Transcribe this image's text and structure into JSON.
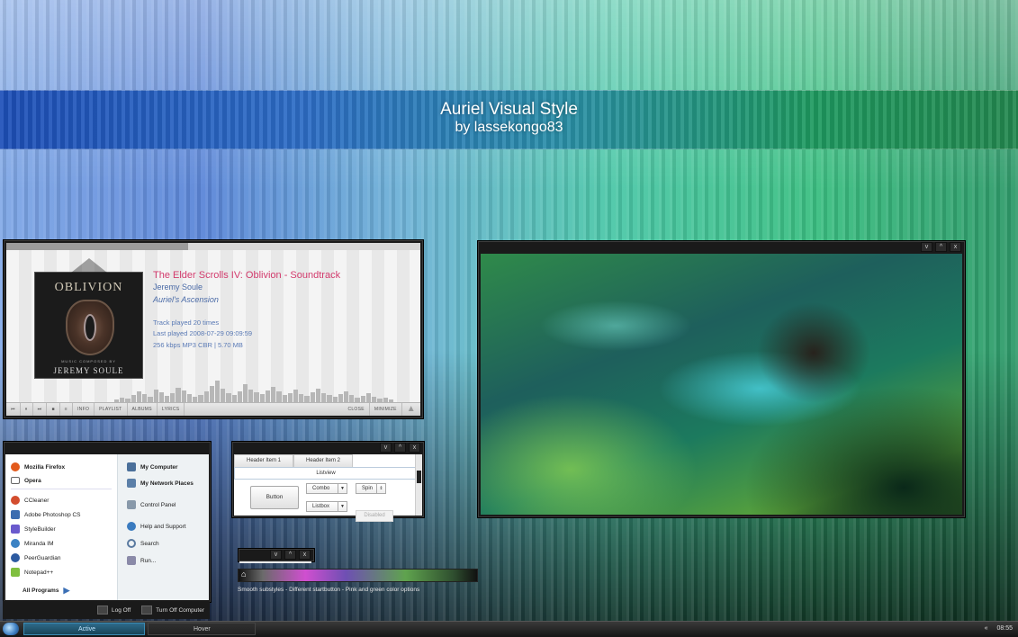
{
  "header": {
    "title": "Auriel Visual Style",
    "author": "by lassekongo83"
  },
  "player": {
    "album_art": {
      "logo": "OBLIVION",
      "composed_by": "MUSIC COMPOSED BY",
      "artist": "JEREMY SOULE"
    },
    "album": "The Elder Scrolls IV: Oblivion - Soundtrack",
    "artist": "Jeremy Soule",
    "track": "Auriel's Ascension",
    "plays": "Track played 20 times",
    "last_played": "Last played 2008-07-29 09:09:59",
    "bitrate": "256 kbps MP3 CBR | 5.70 MB",
    "seek_progress": 0.44,
    "controls": [
      "⏮",
      "⏸",
      "⏭",
      "■",
      "≡"
    ],
    "tabs": [
      "INFO",
      "PLAYLIST",
      "ALBUMS",
      "LYRICS"
    ],
    "right_buttons": [
      "CLOSE",
      "MINIMIZE"
    ]
  },
  "start_menu": {
    "pinned": [
      {
        "label": "Mozilla Firefox",
        "icon": "firefox-icon",
        "color": "#e25a1c"
      },
      {
        "label": "Opera",
        "icon": "mail-icon",
        "color": "#c0392b"
      }
    ],
    "recent": [
      {
        "label": "CCleaner",
        "icon": "ccleaner-icon",
        "color": "#d34d2e"
      },
      {
        "label": "Adobe Photoshop CS",
        "icon": "photoshop-icon",
        "color": "#3c6db0"
      },
      {
        "label": "StyleBuilder",
        "icon": "stylebuilder-icon",
        "color": "#6a5acd"
      },
      {
        "label": "Miranda IM",
        "icon": "miranda-icon",
        "color": "#3b82c4"
      },
      {
        "label": "PeerGuardian",
        "icon": "peerguardian-icon",
        "color": "#2c5aa0"
      },
      {
        "label": "Notepad++",
        "icon": "notepad-icon",
        "color": "#7fbf3f"
      }
    ],
    "all_programs": "All Programs",
    "places": [
      {
        "label": "My Computer",
        "icon": "computer-icon"
      },
      {
        "label": "My Network Places",
        "icon": "network-icon"
      },
      {
        "label": "Control Panel",
        "icon": "control-panel-icon"
      },
      {
        "label": "Help and Support",
        "icon": "help-icon"
      },
      {
        "label": "Search",
        "icon": "search-icon"
      },
      {
        "label": "Run...",
        "icon": "run-icon"
      }
    ],
    "log_off": "Log Off",
    "turn_off": "Turn Off Computer"
  },
  "controls_window": {
    "header_items": [
      "Header Item 1",
      "Header Item 2"
    ],
    "listview": "Listview",
    "button": "Button",
    "combo": "Combo",
    "spin": "Spin",
    "listbox": "Listbox",
    "disabled": "Disabled"
  },
  "caption": "Smooth substyles - Different startbutton - Pink and green color options",
  "taskbar": {
    "active": "Active",
    "hover": "Hover",
    "tray_arrows": "«",
    "clock": "08:55"
  },
  "colors": {
    "accent_pink": "#d23a6c",
    "accent_blue": "#4a6aa6"
  }
}
